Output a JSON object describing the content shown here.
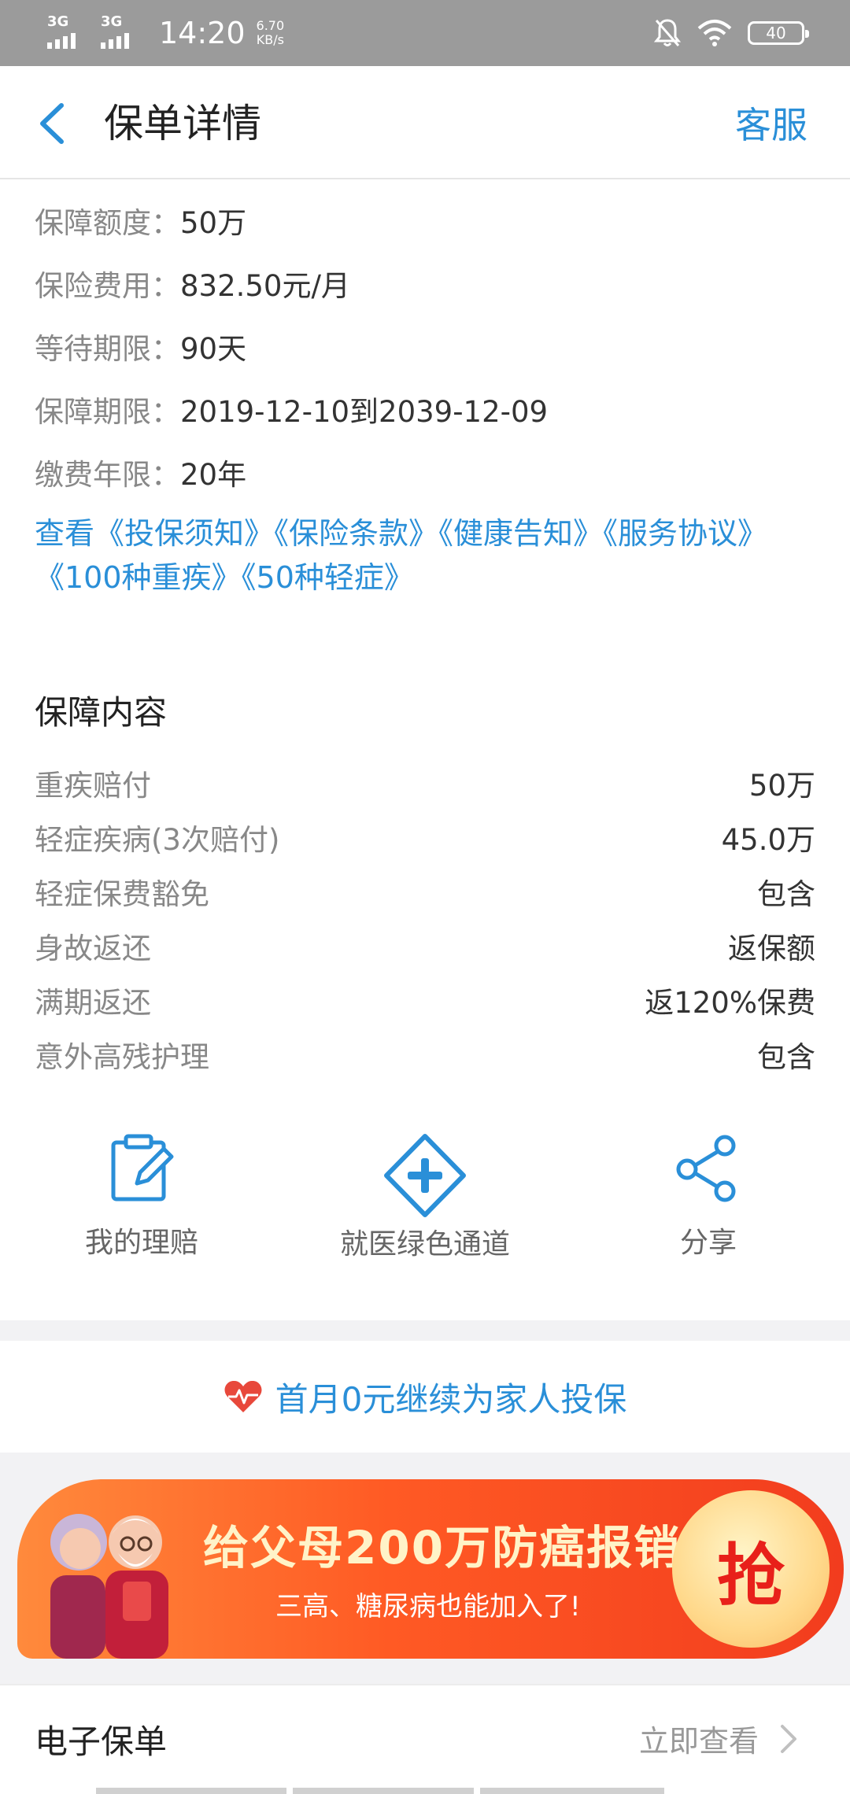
{
  "status_bar": {
    "network1": "3G",
    "network2": "3G",
    "time": "14:20",
    "speed_value": "6.70",
    "speed_unit": "KB/s",
    "battery": "40"
  },
  "header": {
    "title": "保单详情",
    "service": "客服"
  },
  "info": [
    {
      "label": "保障额度：",
      "value": "50万"
    },
    {
      "label": "保险费用：",
      "value": "832.50元/月"
    },
    {
      "label": "等待期限：",
      "value": "90天"
    },
    {
      "label": "保障期限：",
      "value": "2019-12-10到2039-12-09"
    },
    {
      "label": "缴费年限：",
      "value": "20年"
    }
  ],
  "links_text": "查看《投保须知》《保险条款》《健康告知》《服务协议》《100种重疾》《50种轻症》",
  "coverage": {
    "title": "保障内容",
    "rows": [
      {
        "name": "重疾赔付",
        "value": "50万"
      },
      {
        "name": "轻症疾病(3次赔付)",
        "value": "45.0万"
      },
      {
        "name": "轻症保费豁免",
        "value": "包含"
      },
      {
        "name": "身故返还",
        "value": "返保额"
      },
      {
        "name": "满期返还",
        "value": "返120%保费"
      },
      {
        "name": "意外高残护理",
        "value": "包含"
      }
    ]
  },
  "actions": {
    "claims": "我的理赔",
    "green_channel": "就医绿色通道",
    "share": "分享"
  },
  "promo": {
    "text": "首月0元继续为家人投保"
  },
  "banner": {
    "main": "给父母200万防癌报销金",
    "sub": "三高、糖尿病也能加入了!",
    "button": "抢"
  },
  "e_policy": {
    "title": "电子保单",
    "action": "立即查看"
  },
  "colors": {
    "accent": "#2a8fd8",
    "heart": "#e8483b",
    "banner": "#ff5a24"
  }
}
